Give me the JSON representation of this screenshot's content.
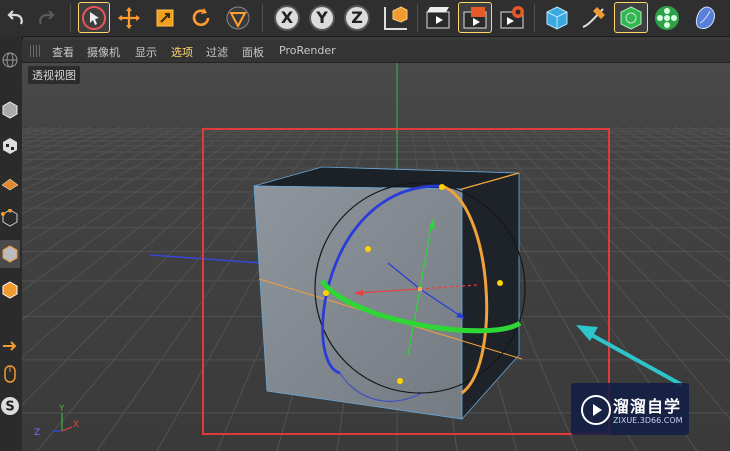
{
  "menu": {
    "items": [
      {
        "label": "查看",
        "active": false
      },
      {
        "label": "摄像机",
        "active": false
      },
      {
        "label": "显示",
        "active": false
      },
      {
        "label": "选项",
        "active": true
      },
      {
        "label": "过滤",
        "active": false
      },
      {
        "label": "面板",
        "active": false
      },
      {
        "label": "ProRender",
        "active": false
      }
    ]
  },
  "viewport": {
    "label": "透视视图",
    "axis_gizmo": {
      "y": "Y",
      "z": "Z",
      "x": "X"
    }
  },
  "toolbar": {
    "axis_x": "X",
    "axis_y": "Y",
    "axis_z": "Z"
  },
  "watermark": {
    "title": "溜溜自学",
    "url": "ZIXUE.3D66.COM"
  },
  "colors": {
    "selection_box": "#e03a3a",
    "annotation_arrow": "#2ec4cc",
    "rotation_x": "#e84040",
    "rotation_y": "#2ed636",
    "rotation_z": "#2a3cd8",
    "highlight_orange": "#f2a23a",
    "active_menu": "#ffd86b"
  }
}
